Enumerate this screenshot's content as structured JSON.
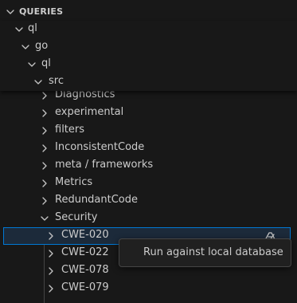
{
  "section": {
    "title": "QUERIES"
  },
  "sticky": [
    {
      "label": "ql"
    },
    {
      "label": "go"
    },
    {
      "label": "ql"
    },
    {
      "label": "src"
    }
  ],
  "tree": [
    {
      "label": "Diagnostics",
      "expanded": false
    },
    {
      "label": "experimental",
      "expanded": false
    },
    {
      "label": "filters",
      "expanded": false
    },
    {
      "label": "InconsistentCode",
      "expanded": false
    },
    {
      "label": "meta / frameworks",
      "expanded": false
    },
    {
      "label": "Metrics",
      "expanded": false
    },
    {
      "label": "RedundantCode",
      "expanded": false
    },
    {
      "label": "Security",
      "expanded": true
    },
    {
      "label": "CWE-020",
      "expanded": false,
      "selected": true
    },
    {
      "label": "CWE-022",
      "expanded": false
    },
    {
      "label": "CWE-078",
      "expanded": false
    },
    {
      "label": "CWE-079",
      "expanded": false
    }
  ],
  "tooltip": {
    "text": "Run against local database"
  },
  "icons": {
    "run": "run-query-icon"
  }
}
